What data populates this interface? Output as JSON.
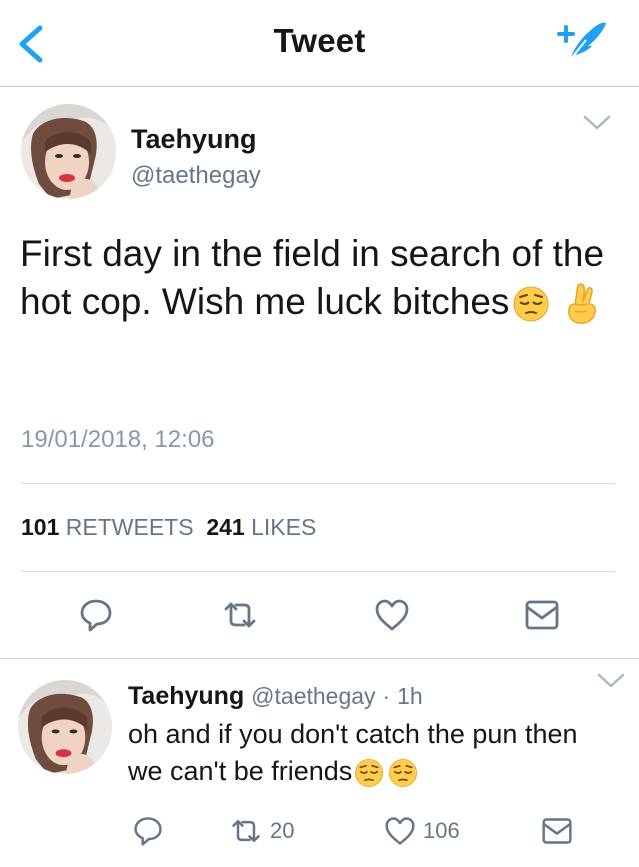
{
  "nav": {
    "title": "Tweet",
    "back_icon": "chevron-left-icon",
    "compose_icon": "compose-tweet-icon",
    "accent": "#1da1f2"
  },
  "tweet": {
    "name": "Taehyung",
    "handle": "@taethegay",
    "text": "First day in the field in search of the hot cop. Wish me luck bitches",
    "emojis": [
      "pensive-face-emoji",
      "crossed-fingers-emoji"
    ],
    "timestamp": "19/01/2018, 12:06",
    "retweets_count": "101",
    "retweets_label": "RETWEETS",
    "likes_count": "241",
    "likes_label": "LIKES",
    "actions": [
      "reply-icon",
      "retweet-icon",
      "like-icon",
      "message-icon"
    ]
  },
  "reply": {
    "name": "Taehyung",
    "handle": "@taethegay",
    "separator": "·",
    "time": "1h",
    "text": "oh and if you don't catch the pun then we can't be friends",
    "emojis": [
      "pensive-face-emoji",
      "pensive-face-emoji"
    ],
    "retweets_count": "20",
    "likes_count": "106",
    "actions": [
      "reply-icon",
      "retweet-icon",
      "like-icon",
      "message-icon"
    ]
  }
}
